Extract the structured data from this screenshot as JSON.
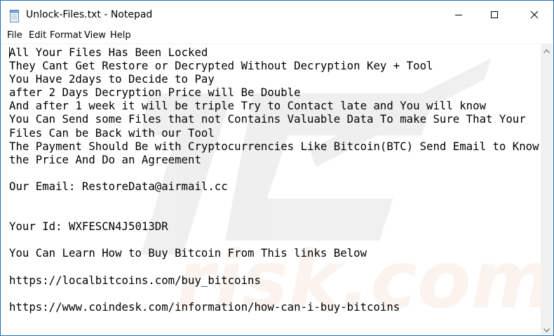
{
  "window": {
    "title": "Unlock-Files.txt - Notepad",
    "accent_border": "#1b6fc4"
  },
  "icons": {
    "app": "notepad-icon",
    "minimize": "minimize-icon",
    "maximize": "maximize-icon",
    "close": "close-icon",
    "scroll_up": "scroll-up-arrow-icon",
    "scroll_down": "scroll-down-arrow-icon"
  },
  "menu": {
    "items": [
      "File",
      "Edit",
      "Format",
      "View",
      "Help"
    ]
  },
  "document": {
    "lines": [
      "All Your Files Has Been Locked",
      "They Cant Get Restore or Decrypted Without Decryption Key + Tool",
      "You Have 2days to Decide to Pay",
      "after 2 Days Decryption Price will Be Double",
      "And after 1 week it will be triple Try to Contact late and You will know",
      "You Can Send some Files that not Contains Valuable Data To make Sure That Your",
      "Files Can be Back with our Tool",
      "The Payment Should Be with Cryptocurrencies Like Bitcoin(BTC) Send Email to Know",
      "the Price And Do an Agreement",
      "",
      "Our Email: RestoreData@airmail.cc",
      "",
      "",
      "Your Id: WXFESCN4J5013DR",
      "",
      "You Can Learn How to Buy Bitcoin From This links Below",
      "",
      "https://localbitcoins.com/buy_bitcoins",
      "",
      "https://www.coindesk.com/information/how-can-i-buy-bitcoins"
    ]
  }
}
